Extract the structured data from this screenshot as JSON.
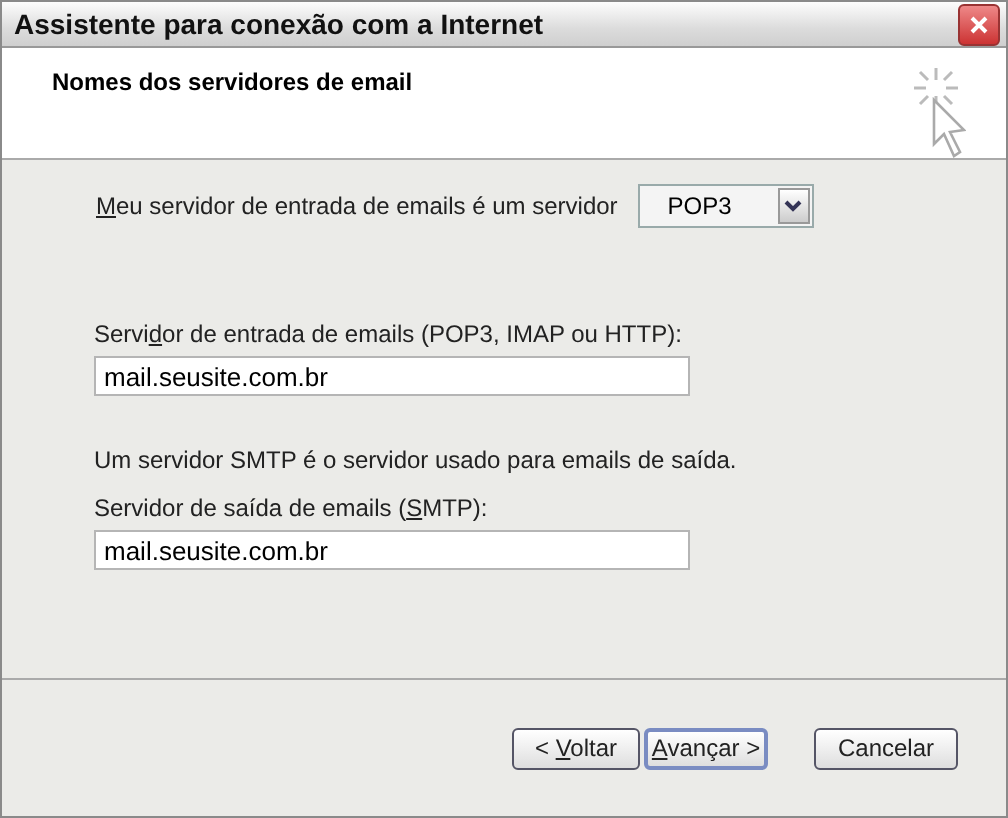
{
  "window": {
    "title": "Assistente para conexão com a Internet"
  },
  "header": {
    "title": "Nomes dos servidores de email"
  },
  "server_type": {
    "label": {
      "key": "M",
      "post": "eu servidor de entrada de emails é um  servidor"
    },
    "value": "POP3"
  },
  "incoming": {
    "label": {
      "pre": "Servi",
      "key": "d",
      "post": "or de entrada de emails (POP3, IMAP ou HTTP):"
    },
    "value": "mail.seusite.com.br"
  },
  "smtp_note": "Um servidor SMTP é o servidor usado para emails de saída.",
  "outgoing": {
    "label": {
      "pre": "Servidor de saída de emails (",
      "key": "S",
      "post": "MTP):"
    },
    "value": "mail.seusite.com.br"
  },
  "buttons": [
    {
      "label": {
        "pre": "< ",
        "key": "V",
        "post": "oltar"
      },
      "default": false
    },
    {
      "label": {
        "key": "A",
        "post": "vançar >"
      },
      "default": true
    },
    {
      "label": {
        "pre": "Cancelar"
      },
      "default": false
    }
  ]
}
